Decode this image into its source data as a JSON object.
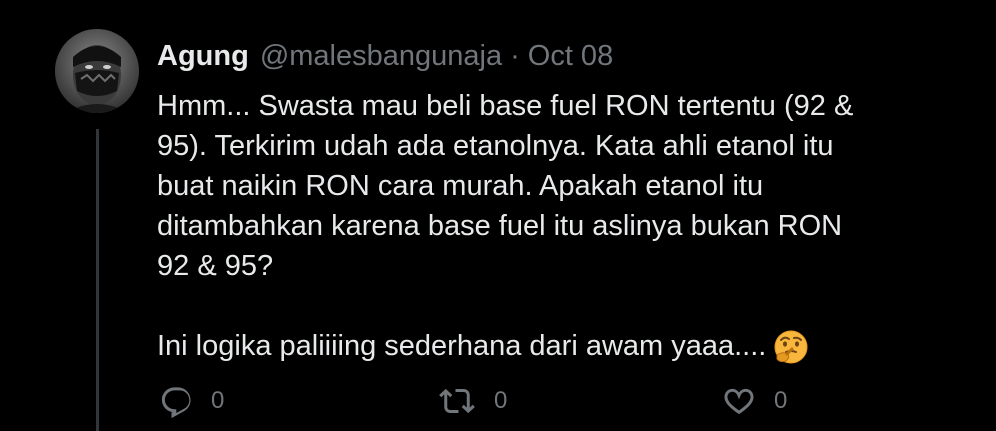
{
  "post": {
    "author": {
      "display_name": "Agung",
      "handle": "@malesbangunaja",
      "avatar_icon": "masked-person-avatar"
    },
    "separator": "·",
    "timestamp": "Oct 08",
    "text_lines": [
      "Hmm... Swasta mau beli base fuel RON tertentu (92 &",
      "95). Terkirim udah ada etanolnya. Kata ahli etanol itu",
      "buat naikin RON cara murah. Apakah etanol itu",
      "ditambahkan karena base fuel itu aslinya bukan RON",
      "92 & 95?"
    ],
    "closing_line": "Ini logika paliiiing sederhana dari awam yaaa....",
    "emoji": "thinking-face-emoji",
    "actions": {
      "reply": {
        "icon": "reply-icon",
        "count": "0"
      },
      "repost": {
        "icon": "repost-icon",
        "count": "0"
      },
      "like": {
        "icon": "heart-icon",
        "count": "0"
      }
    }
  },
  "colors": {
    "background": "#000000",
    "text_primary": "#e7e9ea",
    "text_secondary": "#71767b",
    "thread_line": "#333639",
    "emoji_face": "#f8b73c"
  }
}
